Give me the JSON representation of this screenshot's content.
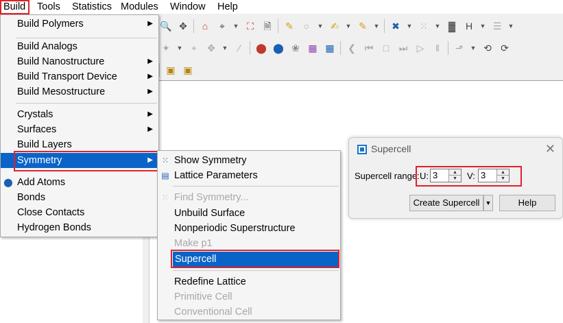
{
  "menubar": {
    "items": [
      {
        "label": "Build",
        "ul": "B",
        "rest": "uild"
      },
      {
        "label": "Tools",
        "ul": "T",
        "rest": "ools"
      },
      {
        "label": "Statistics",
        "ul": "S",
        "rest": "tatistics"
      },
      {
        "label": "Modules",
        "ul": "o",
        "pre": "M",
        "rest": "dules"
      },
      {
        "label": "Window",
        "ul": "W",
        "rest": "indow"
      },
      {
        "label": "Help",
        "ul": "H",
        "rest": "elp"
      }
    ]
  },
  "build_menu": {
    "items": [
      {
        "label": "Build Polymers",
        "submenu": true
      },
      {
        "label": "Build Analogs",
        "submenu": false
      },
      {
        "label": "Build Nanostructure",
        "submenu": true
      },
      {
        "label": "Build Transport Device",
        "submenu": true
      },
      {
        "label": "Build Mesostructure",
        "submenu": true
      },
      {
        "label": "Crystals",
        "submenu": true
      },
      {
        "label": "Surfaces",
        "submenu": true
      },
      {
        "label": "Build Layers",
        "submenu": false
      },
      {
        "label": "Symmetry",
        "submenu": true
      },
      {
        "label": "Add Atoms",
        "submenu": false
      },
      {
        "label": "Bonds",
        "submenu": false
      },
      {
        "label": "Close Contacts",
        "submenu": false
      },
      {
        "label": "Hydrogen Bonds",
        "submenu": false
      }
    ]
  },
  "symmetry_menu": {
    "items": [
      {
        "label": "Show Symmetry",
        "disabled": false
      },
      {
        "label": "Lattice Parameters",
        "disabled": false
      },
      {
        "label": "Find Symmetry...",
        "disabled": true
      },
      {
        "label": "Unbuild Surface",
        "disabled": false
      },
      {
        "label": "Nonperiodic Superstructure",
        "disabled": false
      },
      {
        "label": "Make p1",
        "disabled": true
      },
      {
        "label": "Supercell",
        "disabled": false
      },
      {
        "label": "Redefine Lattice",
        "disabled": false
      },
      {
        "label": "Primitive Cell",
        "disabled": true
      },
      {
        "label": "Conventional Cell",
        "disabled": true
      }
    ]
  },
  "dialog": {
    "title": "Supercell",
    "range_label": "Supercell range:",
    "u_label": "U:",
    "u_value": "3",
    "v_label": "V:",
    "v_value": "3",
    "create_button": "Create Supercell",
    "help_button": "Help"
  },
  "colors": {
    "highlight": "#0a64c8",
    "annotation": "#e0212b"
  }
}
